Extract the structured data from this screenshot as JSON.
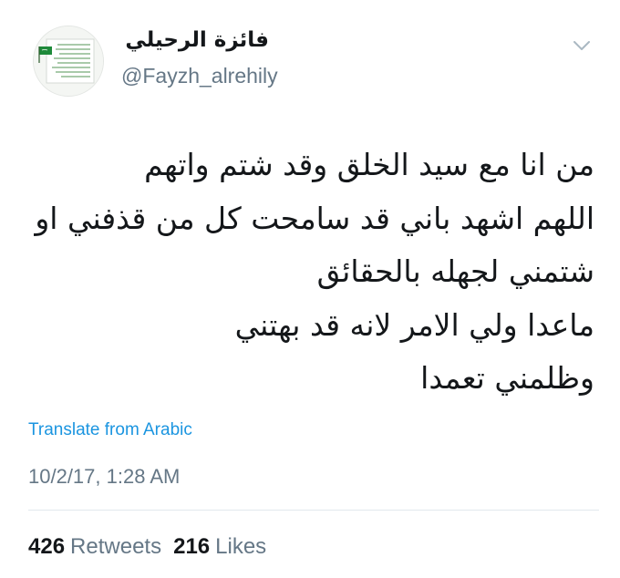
{
  "user": {
    "display_name": "فائزة الرحيلي",
    "handle": "@Fayzh_alrehily",
    "avatar_icon": "profile-picture-green-flag-text-card"
  },
  "menu": {
    "caret_icon": "chevron-down-icon"
  },
  "tweet": {
    "lines": [
      "من انا مع سيد الخلق وقد شتم واتهم",
      "اللهم اشهد باني قد سامحت كل من قذفني او",
      "شتمني لجهله بالحقائق",
      "ماعدا ولي الامر لانه قد بهتني",
      "وظلمني تعمدا"
    ],
    "translate_label": "Translate from Arabic",
    "timestamp": "10/2/17, 1:28 AM"
  },
  "stats": {
    "retweets_count": "426",
    "retweets_label": "Retweets",
    "likes_count": "216",
    "likes_label": "Likes"
  },
  "colors": {
    "link": "#1b95e0",
    "muted": "#657786",
    "text": "#14171a",
    "divider": "#e1e8ed",
    "avatar_flag_green": "#1e8a3a"
  }
}
